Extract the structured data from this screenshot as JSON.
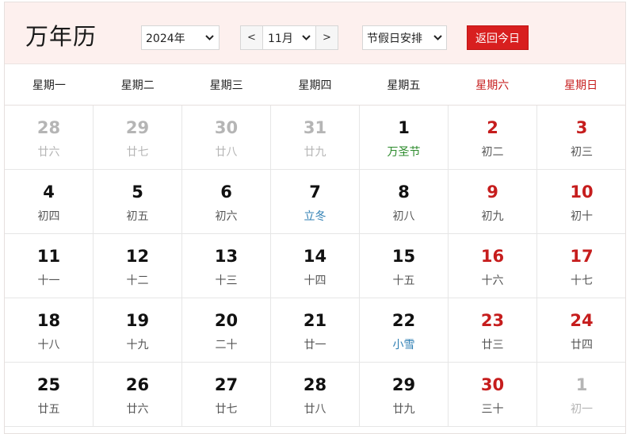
{
  "header": {
    "title": "万年历",
    "year": "2024年",
    "month": "11月",
    "prev": "<",
    "next": ">",
    "holiday": "节假日安排",
    "today": "返回今日"
  },
  "weekdays": [
    "星期一",
    "星期二",
    "星期三",
    "星期四",
    "星期五",
    "星期六",
    "星期日"
  ],
  "colors": {
    "accent_red": "#d81f1f",
    "weekend_red": "#c61d1d",
    "festival_green": "#2a8a2a",
    "solar_term_blue": "#2f7fb3",
    "muted": "#b5b5b5",
    "header_bg": "#fdf0ee"
  },
  "weeks": [
    [
      {
        "day": "28",
        "lunar": "廿六",
        "other": true
      },
      {
        "day": "29",
        "lunar": "廿七",
        "other": true
      },
      {
        "day": "30",
        "lunar": "廿八",
        "other": true
      },
      {
        "day": "31",
        "lunar": "廿九",
        "other": true
      },
      {
        "day": "1",
        "lunar": "万圣节",
        "kind": "festival"
      },
      {
        "day": "2",
        "lunar": "初二"
      },
      {
        "day": "3",
        "lunar": "初三"
      }
    ],
    [
      {
        "day": "4",
        "lunar": "初四"
      },
      {
        "day": "5",
        "lunar": "初五"
      },
      {
        "day": "6",
        "lunar": "初六"
      },
      {
        "day": "7",
        "lunar": "立冬",
        "kind": "term"
      },
      {
        "day": "8",
        "lunar": "初八"
      },
      {
        "day": "9",
        "lunar": "初九"
      },
      {
        "day": "10",
        "lunar": "初十"
      }
    ],
    [
      {
        "day": "11",
        "lunar": "十一"
      },
      {
        "day": "12",
        "lunar": "十二"
      },
      {
        "day": "13",
        "lunar": "十三"
      },
      {
        "day": "14",
        "lunar": "十四"
      },
      {
        "day": "15",
        "lunar": "十五"
      },
      {
        "day": "16",
        "lunar": "十六"
      },
      {
        "day": "17",
        "lunar": "十七"
      }
    ],
    [
      {
        "day": "18",
        "lunar": "十八"
      },
      {
        "day": "19",
        "lunar": "十九"
      },
      {
        "day": "20",
        "lunar": "二十"
      },
      {
        "day": "21",
        "lunar": "廿一"
      },
      {
        "day": "22",
        "lunar": "小雪",
        "kind": "term"
      },
      {
        "day": "23",
        "lunar": "廿三"
      },
      {
        "day": "24",
        "lunar": "廿四"
      }
    ],
    [
      {
        "day": "25",
        "lunar": "廿五"
      },
      {
        "day": "26",
        "lunar": "廿六"
      },
      {
        "day": "27",
        "lunar": "廿七"
      },
      {
        "day": "28",
        "lunar": "廿八"
      },
      {
        "day": "29",
        "lunar": "廿九"
      },
      {
        "day": "30",
        "lunar": "三十"
      },
      {
        "day": "1",
        "lunar": "初一",
        "other": true
      }
    ]
  ]
}
